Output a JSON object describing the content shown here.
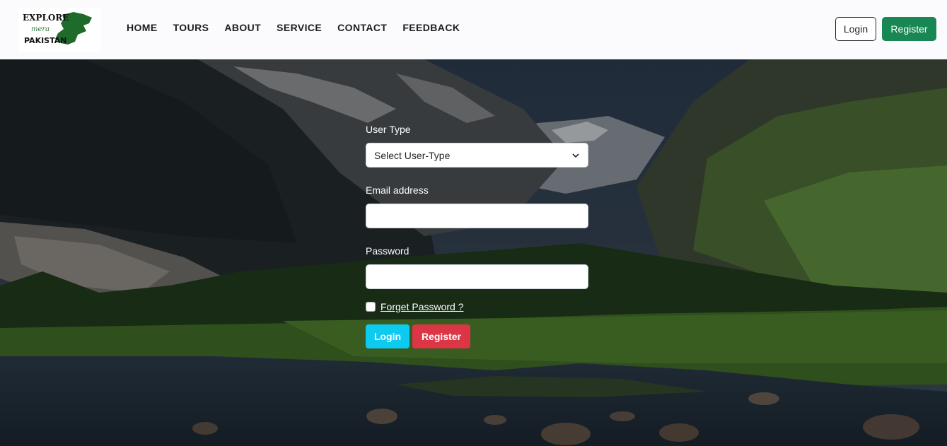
{
  "brand": {
    "logo_line1": "EXPLORE",
    "logo_line2": "mera",
    "logo_line3": "PAKISTAN",
    "logo_color": "#1f6b2b"
  },
  "nav": {
    "links": [
      "HOME",
      "TOURS",
      "ABOUT",
      "SERVICE",
      "CONTACT",
      "FEEDBACK"
    ],
    "login_label": "Login",
    "register_label": "Register"
  },
  "form": {
    "user_type_label": "User Type",
    "user_type_selected": "Select User-Type",
    "email_label": "Email address",
    "email_value": "",
    "password_label": "Password",
    "password_value": "",
    "forget_label": "Forget Password ?",
    "login_label": "Login",
    "register_label": "Register"
  },
  "colors": {
    "login_btn": "#0dcaf0",
    "register_btn": "#dc3545",
    "nav_register_btn": "#198754"
  }
}
